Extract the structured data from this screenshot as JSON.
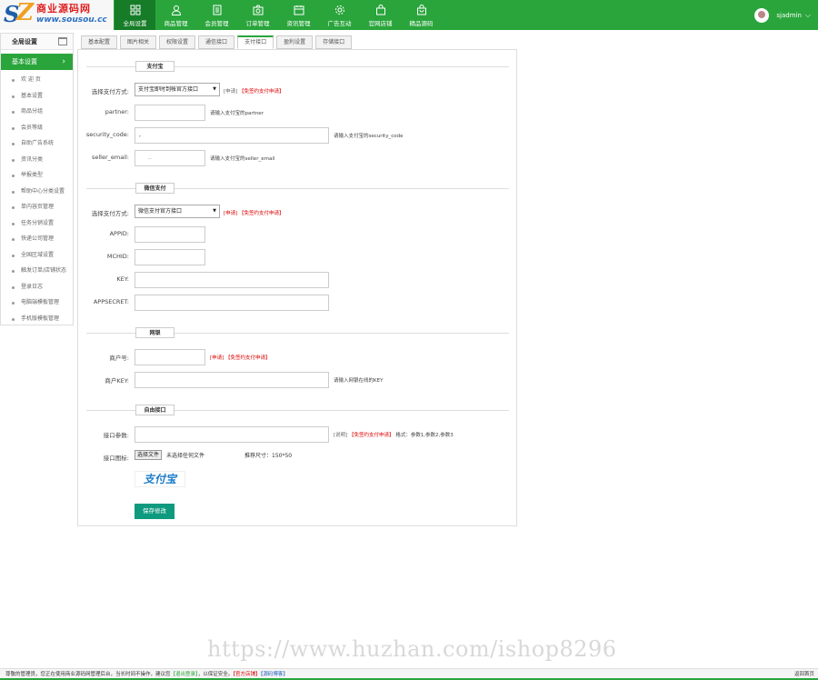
{
  "logo": {
    "text": "商业源码网",
    "url": "www.sousou.cc"
  },
  "nav": [
    {
      "label": "全局设置",
      "icon": "grid-icon"
    },
    {
      "label": "商品管理",
      "icon": "user-icon"
    },
    {
      "label": "会员管理",
      "icon": "document-icon"
    },
    {
      "label": "订单管理",
      "icon": "camera-icon"
    },
    {
      "label": "资讯管理",
      "icon": "calendar-icon"
    },
    {
      "label": "广告互动",
      "icon": "gear-icon"
    },
    {
      "label": "官网店铺",
      "icon": "bag-icon"
    },
    {
      "label": "精品源码",
      "icon": "shopping-bag-icon"
    }
  ],
  "user": {
    "name": "sjadmin"
  },
  "sidebar": {
    "title": "全局设置",
    "current": "基本设置",
    "items": [
      "欢 迎 页",
      "基本设置",
      "商品分组",
      "会员等级",
      "自助广告系统",
      "资讯分类",
      "举报类型",
      "帮助中心分类设置",
      "单内容页管理",
      "任务分销设置",
      "快递公司管理",
      "全国区域设置",
      "触发订单/店铺状态",
      "登录日志",
      "电脑端模板管理",
      "手机版模板管理"
    ]
  },
  "tabs": [
    "基本配置",
    "图片相关",
    "权限设置",
    "通信接口",
    "支付接口",
    "盈利设置",
    "存储接口"
  ],
  "alipay": {
    "legend": "支付宝",
    "method_label": "选择支付方式:",
    "method_value": "支付宝即时到帐官方接口",
    "apply_prefix": "[申请]",
    "apply_link": "【免签约支付申请】",
    "partner_label": "partner:",
    "partner_hint": "请输入支付宝的partner",
    "security_label": "security_code:",
    "security_value": ",",
    "security_hint": "请输入支付宝的security_code",
    "seller_label": "seller_email:",
    "seller_value": "..",
    "seller_hint": "请输入支付宝的seller_email"
  },
  "wechat": {
    "legend": "微信支付",
    "method_label": "选择支付方式:",
    "method_value": "微信支付官方接口",
    "apply_prefix": "[申请]",
    "apply_link": "【免签约支付申请】",
    "appid_label": "APPID:",
    "mchid_label": "MCHID:",
    "key_label": "KEY:",
    "appsecret_label": "APPSECRET:"
  },
  "netbank": {
    "legend": "网银",
    "merchant_label": "商户号:",
    "apply_prefix": "[申请]",
    "apply_link": "【免签约支付申请】",
    "key_label": "商户KEY:",
    "key_hint": "请输入网银在线的KEY"
  },
  "custom": {
    "legend": "自由接口",
    "params_label": "接口参数:",
    "explain_prefix": "[说明]",
    "apply_link": "【免签约支付申请】",
    "format_hint": "格式：参数1,参数2,参数3",
    "icon_label": "接口图标:",
    "file_button": "选择文件",
    "file_status": "未选择任何文件",
    "size_hint": "推荐尺寸：150*50",
    "logo_text": "支付宝"
  },
  "save_button": "保存修改",
  "watermark": "https://www.huzhan.com/ishop8296",
  "footer": {
    "text1": "尊敬的管理员，您正在使用商业源码网管理后台，当长时间不操作，建议您",
    "logout": "【退出登录】",
    "text2": "，以保证安全。",
    "official": "【官方店铺】",
    "source": "【源码博客】",
    "back": "返回首页"
  }
}
